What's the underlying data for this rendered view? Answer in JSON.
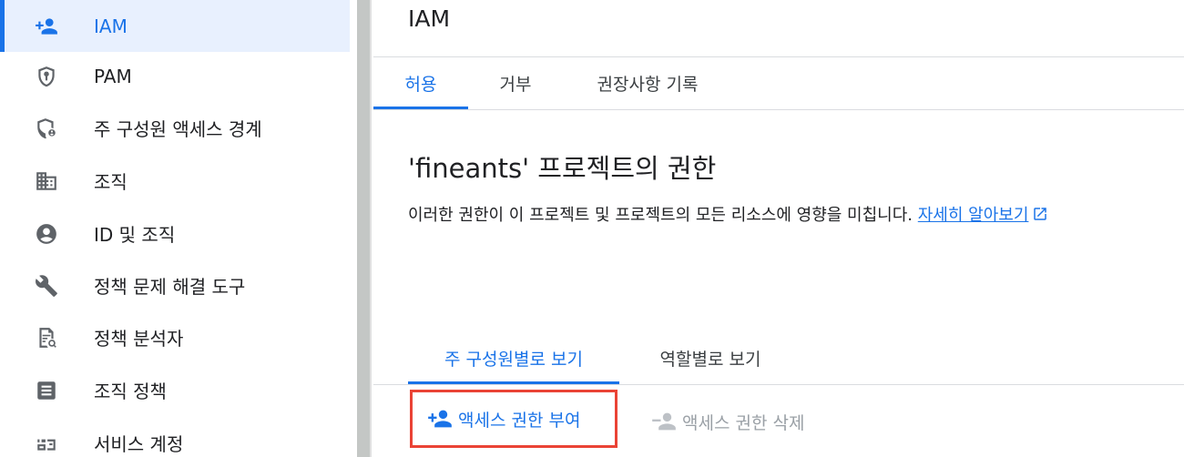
{
  "sidebar": {
    "items": [
      {
        "label": "IAM",
        "icon": "person-add-icon",
        "active": true
      },
      {
        "label": "PAM",
        "icon": "shield-keyhole-icon"
      },
      {
        "label": "주 구성원 액세스 경계",
        "icon": "shield-person-icon"
      },
      {
        "label": "조직",
        "icon": "building-icon"
      },
      {
        "label": "ID 및 조직",
        "icon": "account-circle-icon"
      },
      {
        "label": "정책 문제 해결 도구",
        "icon": "wrench-icon"
      },
      {
        "label": "정책 분석자",
        "icon": "document-search-icon"
      },
      {
        "label": "조직 정책",
        "icon": "list-document-icon"
      },
      {
        "label": "서비스 계정",
        "icon": "service-account-icon"
      }
    ]
  },
  "header": {
    "title": "IAM"
  },
  "tabs": [
    {
      "label": "허용",
      "active": true
    },
    {
      "label": "거부"
    },
    {
      "label": "권장사항 기록"
    }
  ],
  "permissions": {
    "title": "'fineants' 프로젝트의 권한",
    "description": "이러한 권한이 이 프로젝트 및 프로젝트의 모든 리소스에 영향을 미칩니다.",
    "learn_more": "자세히 알아보기"
  },
  "view_tabs": [
    {
      "label": "주 구성원별로 보기",
      "active": true
    },
    {
      "label": "역할별로 보기"
    }
  ],
  "actions": {
    "grant_label": "액세스 권한 부여",
    "remove_label": "액세스 권한 삭제"
  },
  "colors": {
    "accent": "#1a73e8",
    "highlight_border": "#ea4335",
    "active_bg": "#e8f0fe"
  }
}
